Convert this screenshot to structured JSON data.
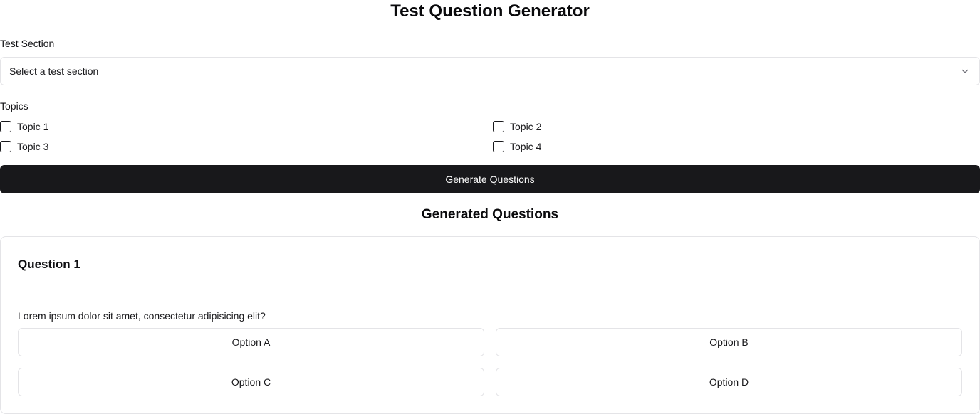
{
  "header": {
    "title": "Test Question Generator"
  },
  "form": {
    "section_label": "Test Section",
    "section_select_value": "Select a test section",
    "topics_label": "Topics",
    "topics": [
      {
        "label": "Topic 1",
        "checked": false
      },
      {
        "label": "Topic 2",
        "checked": false
      },
      {
        "label": "Topic 3",
        "checked": false
      },
      {
        "label": "Topic 4",
        "checked": false
      }
    ],
    "generate_label": "Generate Questions"
  },
  "results": {
    "title": "Generated Questions",
    "questions": [
      {
        "title": "Question 1",
        "text": "Lorem ipsum dolor sit amet, consectetur adipisicing elit?",
        "options": [
          "Option A",
          "Option B",
          "Option C",
          "Option D"
        ]
      }
    ]
  },
  "icons": {
    "select_chevron": "chevron-down-icon"
  },
  "colors": {
    "primary_button_bg": "#18181b",
    "primary_button_text": "#fafafa",
    "border": "#e4e4e7"
  }
}
